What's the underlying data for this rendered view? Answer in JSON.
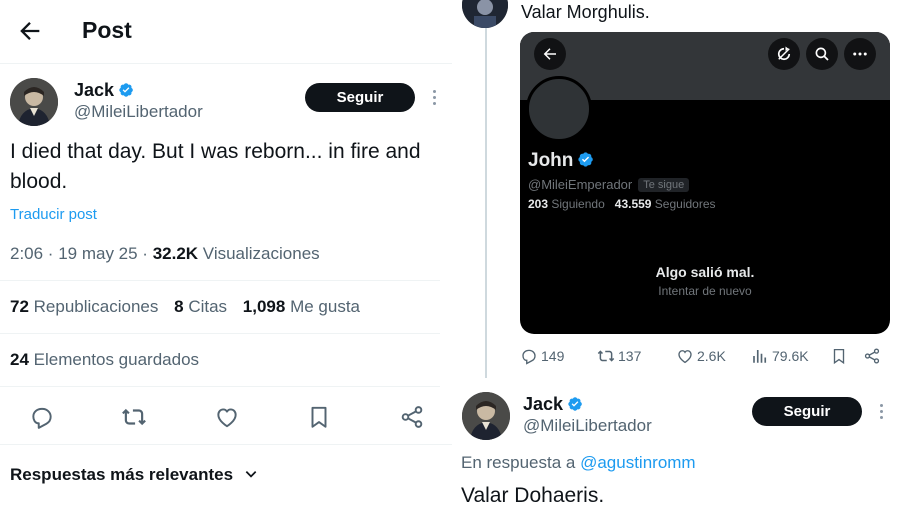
{
  "left": {
    "header": {
      "title": "Post"
    },
    "author": {
      "name": "Jack",
      "handle": "@MileiLibertador"
    },
    "follow_label": "Seguir",
    "post_text": "I died that day. But I was reborn... in fire and blood.",
    "translate_label": "Traducir post",
    "meta": {
      "time": "2:06 · 19 may 25 · ",
      "views_count": "32.2K",
      "views_label": " Visualizaciones"
    },
    "stats": {
      "reposts_count": "72",
      "reposts_label": " Republicaciones",
      "quotes_count": "8",
      "quotes_label": " Citas",
      "likes_count": "1,098",
      "likes_label": " Me gusta"
    },
    "saved": {
      "count": "24",
      "label": " Elementos guardados"
    },
    "replies_sort_label": "Respuestas más relevantes",
    "icons": [
      "back-arrow-icon",
      "verified-icon",
      "more-icon",
      "reply-icon",
      "repost-icon",
      "like-icon",
      "bookmark-icon",
      "share-icon",
      "chevron-down-icon"
    ]
  },
  "right": {
    "previous_reply_text": "Valar Morghulis.",
    "embed": {
      "name": "John",
      "handle": "@MileiEmperador",
      "follows_you": "Te sigue",
      "following_count": "203",
      "following_label": " Siguiendo",
      "followers_count": "43.559",
      "followers_label": " Seguidores",
      "error_title": "Algo salió mal.",
      "error_retry": "Intentar de nuevo"
    },
    "action_counts": {
      "replies": "149",
      "reposts": "137",
      "likes": "2.6K",
      "views": "79.6K"
    },
    "reply": {
      "author_name": "Jack",
      "author_handle": "@MileiLibertador",
      "follow_label": "Seguir",
      "in_reply_to_label": "En respuesta a ",
      "in_reply_to_handle": "@agustinromm",
      "text": "Valar Dohaeris."
    }
  },
  "colors": {
    "accent": "#1d9bf0",
    "text": "#0f1419",
    "muted": "#536471",
    "embed_bg": "#000000"
  }
}
